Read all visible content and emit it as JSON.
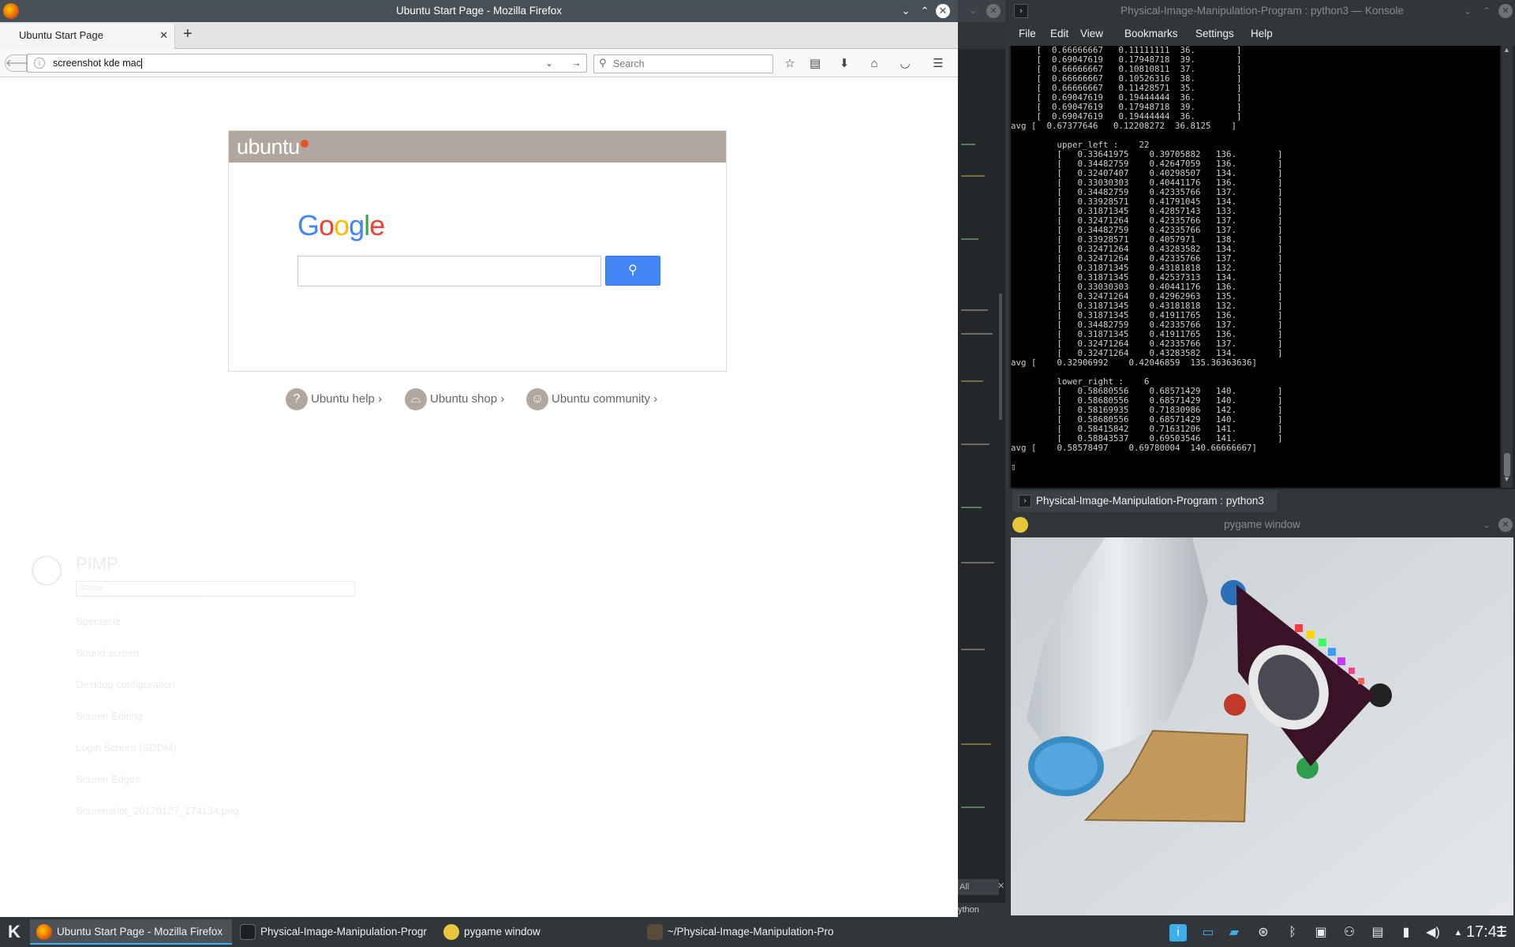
{
  "firefox": {
    "window_title": "Ubuntu Start Page - Mozilla Firefox",
    "tab_title": "Ubuntu Start Page",
    "url_value": "screenshot kde mac",
    "search_placeholder": "Search",
    "page": {
      "brand": "ubuntu",
      "google_logo": "Google",
      "links": [
        "Ubuntu help ›",
        "Ubuntu shop ›",
        "Ubuntu community ›"
      ]
    },
    "ghost_launcher": {
      "title": "PIMP",
      "search": "scree",
      "items": [
        "Spectacle",
        "Sound screen",
        "Desktop configuration",
        "Screen Editing",
        "Login Screen (SDDM)",
        "Screen Edges",
        "Screenshot_20170127_174134.png"
      ]
    }
  },
  "kate": {
    "tab_all": "All",
    "python_label": "ython"
  },
  "konsole": {
    "window_title": "Physical-Image-Manipulation-Program : python3 — Konsole",
    "menu": [
      "File",
      "Edit",
      "View",
      "Bookmarks",
      "Settings",
      "Help"
    ],
    "tab_title": "Physical-Image-Manipulation-Program : python3",
    "lines": [
      "     [  0.66666667   0.11111111  36.        ]",
      "     [  0.69047619   0.17948718  39.        ]",
      "     [  0.66666667   0.10810811  37.        ]",
      "     [  0.66666667   0.10526316  38.        ]",
      "     [  0.66666667   0.11428571  35.        ]",
      "     [  0.69047619   0.19444444  36.        ]",
      "     [  0.69047619   0.17948718  39.        ]",
      "     [  0.69047619   0.19444444  36.        ]",
      "avg [  0.67377646   0.12208272  36.8125    ]",
      "",
      "         upper_left :    22",
      "         [   0.33641975    0.39705882   136.        ]",
      "         [   0.34482759    0.42647059   136.        ]",
      "         [   0.32407407    0.40298507   134.        ]",
      "         [   0.33030303    0.40441176   136.        ]",
      "         [   0.34482759    0.42335766   137.        ]",
      "         [   0.33928571    0.41791045   134.        ]",
      "         [   0.31871345    0.42857143   133.        ]",
      "         [   0.32471264    0.42335766   137.        ]",
      "         [   0.34482759    0.42335766   137.        ]",
      "         [   0.33928571    0.4057971    138.        ]",
      "         [   0.32471264    0.43283582   134.        ]",
      "         [   0.32471264    0.42335766   137.        ]",
      "         [   0.31871345    0.43181818   132.        ]",
      "         [   0.31871345    0.42537313   134.        ]",
      "         [   0.33030303    0.40441176   136.        ]",
      "         [   0.32471264    0.42962963   135.        ]",
      "         [   0.31871345    0.43181818   132.        ]",
      "         [   0.31871345    0.41911765   136.        ]",
      "         [   0.34482759    0.42335766   137.        ]",
      "         [   0.31871345    0.41911765   136.        ]",
      "         [   0.32471264    0.42335766   137.        ]",
      "         [   0.32471264    0.43283582   134.        ]",
      "avg [    0.32906992    0.42046859  135.36363636]",
      "",
      "         lower_right :    6",
      "         [   0.58680556    0.68571429   140.        ]",
      "         [   0.58680556    0.68571429   140.        ]",
      "         [   0.58169935    0.71830986   142.        ]",
      "         [   0.58680556    0.68571429   140.        ]",
      "         [   0.58415842    0.71631206   141.        ]",
      "         [   0.58843537    0.69503546   141.        ]",
      "avg [    0.58578497    0.69780004  140.66666667]",
      "",
      "▯"
    ]
  },
  "pygame": {
    "window_title": "pygame window"
  },
  "taskbar": {
    "tasks": [
      "Ubuntu Start Page - Mozilla Firefox",
      "Physical-Image-Manipulation-Progr",
      "pygame window",
      "~/Physical-Image-Manipulation-Pro"
    ],
    "clock": "17:41"
  },
  "colors": {
    "kde_dark": "#31363b",
    "ubuntu_header": "#b1a79e",
    "google_blue": "#4285f4",
    "firefox_title": "#475057"
  }
}
